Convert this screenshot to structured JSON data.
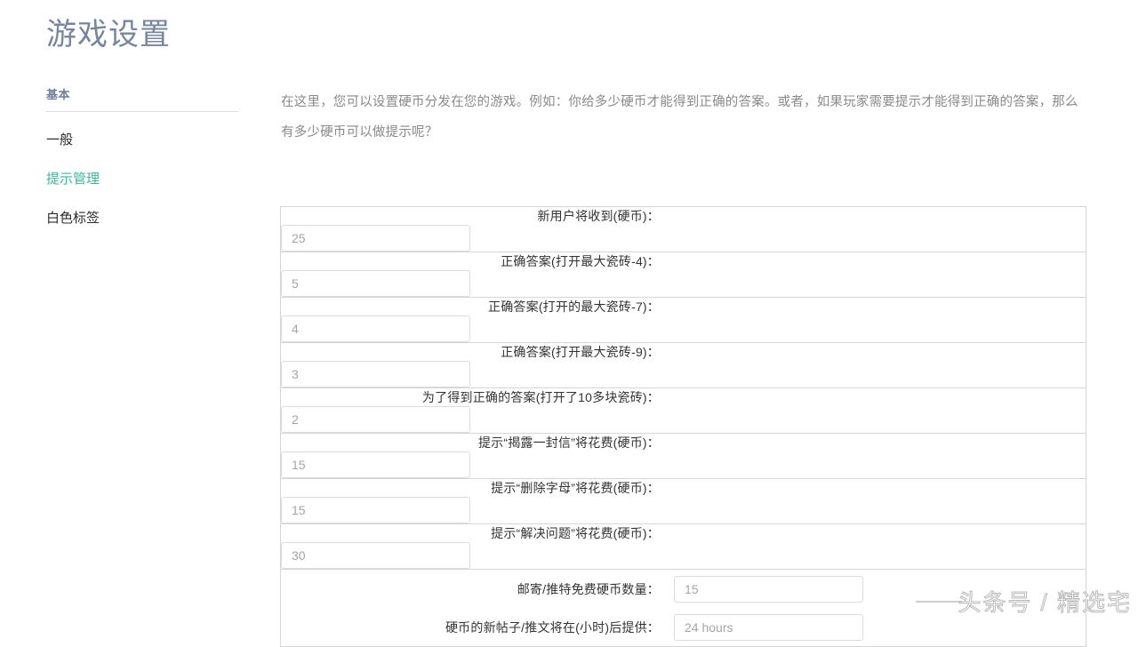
{
  "page": {
    "title": "游戏设置"
  },
  "sidebar": {
    "heading": "基本",
    "items": [
      {
        "label": "一般",
        "active": false
      },
      {
        "label": "提示管理",
        "active": true
      },
      {
        "label": "白色标签",
        "active": false
      }
    ]
  },
  "main": {
    "intro": "在这里，您可以设置硬币分发在您的游戏。例如：你给多少硬币才能得到正确的答案。或者，如果玩家需要提示才能得到正确的答案，那么有多少硬币可以做提示呢？"
  },
  "form": {
    "rows": [
      {
        "label": "新用户将收到(硬币)：",
        "value": "25"
      },
      {
        "label": "正确答案(打开最大瓷砖-4)：",
        "value": "5"
      },
      {
        "label": "正确答案(打开的最大瓷砖-7)：",
        "value": "4"
      },
      {
        "label": "正确答案(打开最大瓷砖-9)：",
        "value": "3"
      },
      {
        "label": "为了得到正确的答案(打开了10多块瓷砖)：",
        "value": "2"
      },
      {
        "label": "提示“揭露一封信”将花费(硬币)：",
        "value": "15"
      },
      {
        "label": "提示“删除字母”将花费(硬币)：",
        "value": "15"
      },
      {
        "label": "提示“解决问题”将花费(硬币)：",
        "value": "30"
      }
    ],
    "group_rows": [
      {
        "label": "邮寄/推特免费硬币数量：",
        "value": "15"
      },
      {
        "label": "硬币的新帖子/推文将在(小时)后提供：",
        "value": "24 hours"
      }
    ]
  },
  "watermark": {
    "text": "头条号 / 精选宅"
  },
  "colors": {
    "title": "#76869e",
    "accent": "#3bb6a0",
    "label": "#333333",
    "muted": "#8a8a8a",
    "border": "#d6d6d6"
  }
}
